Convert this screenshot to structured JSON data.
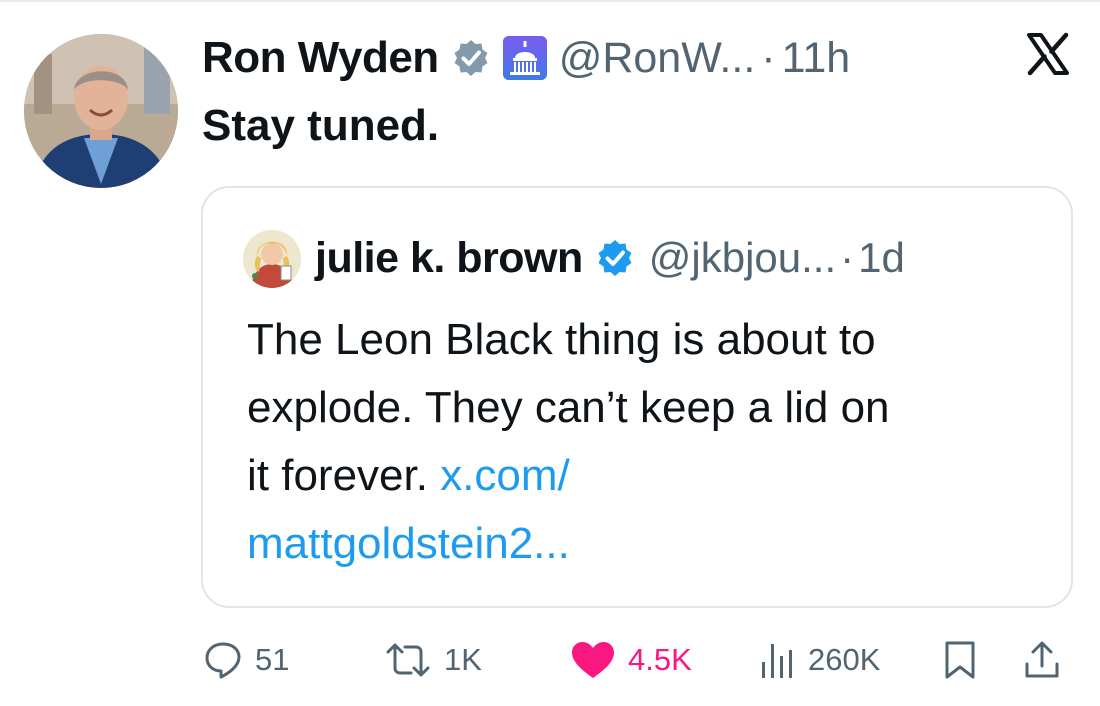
{
  "tweet": {
    "author_name": "Ron Wyden",
    "handle": "@RonW...",
    "separator": "·",
    "time": "11h",
    "text": "Stay tuned."
  },
  "quote": {
    "author_name": "julie k. brown",
    "handle": "@jkbjou...",
    "separator": "·",
    "time": "1d",
    "text_lines": [
      "The Leon Black thing is about to",
      "explode. They can’t keep a lid on",
      "it forever. "
    ],
    "link_line_1": "x.com/",
    "link_line_2": "mattgoldstein2..."
  },
  "actions": {
    "replies": "51",
    "reposts": "1K",
    "likes": "4.5K",
    "views": "260K"
  },
  "colors": {
    "text": "#0f1419",
    "secondary": "#536471",
    "link": "#1d9bf0",
    "like": "#f91880",
    "verified_gray": "#829aab",
    "verified_blue": "#1d9bf0",
    "border": "#dfe5ea"
  },
  "icons": {
    "platform": "x-logo-icon",
    "verified_gray": "verified-gray-badge-icon",
    "government": "capitol-dome-icon",
    "verified_blue": "verified-blue-badge-icon",
    "reply": "speech-bubble-icon",
    "repost": "repost-arrows-icon",
    "like": "heart-filled-icon",
    "views": "bar-chart-icon",
    "bookmark": "bookmark-icon",
    "share": "share-upload-icon"
  }
}
